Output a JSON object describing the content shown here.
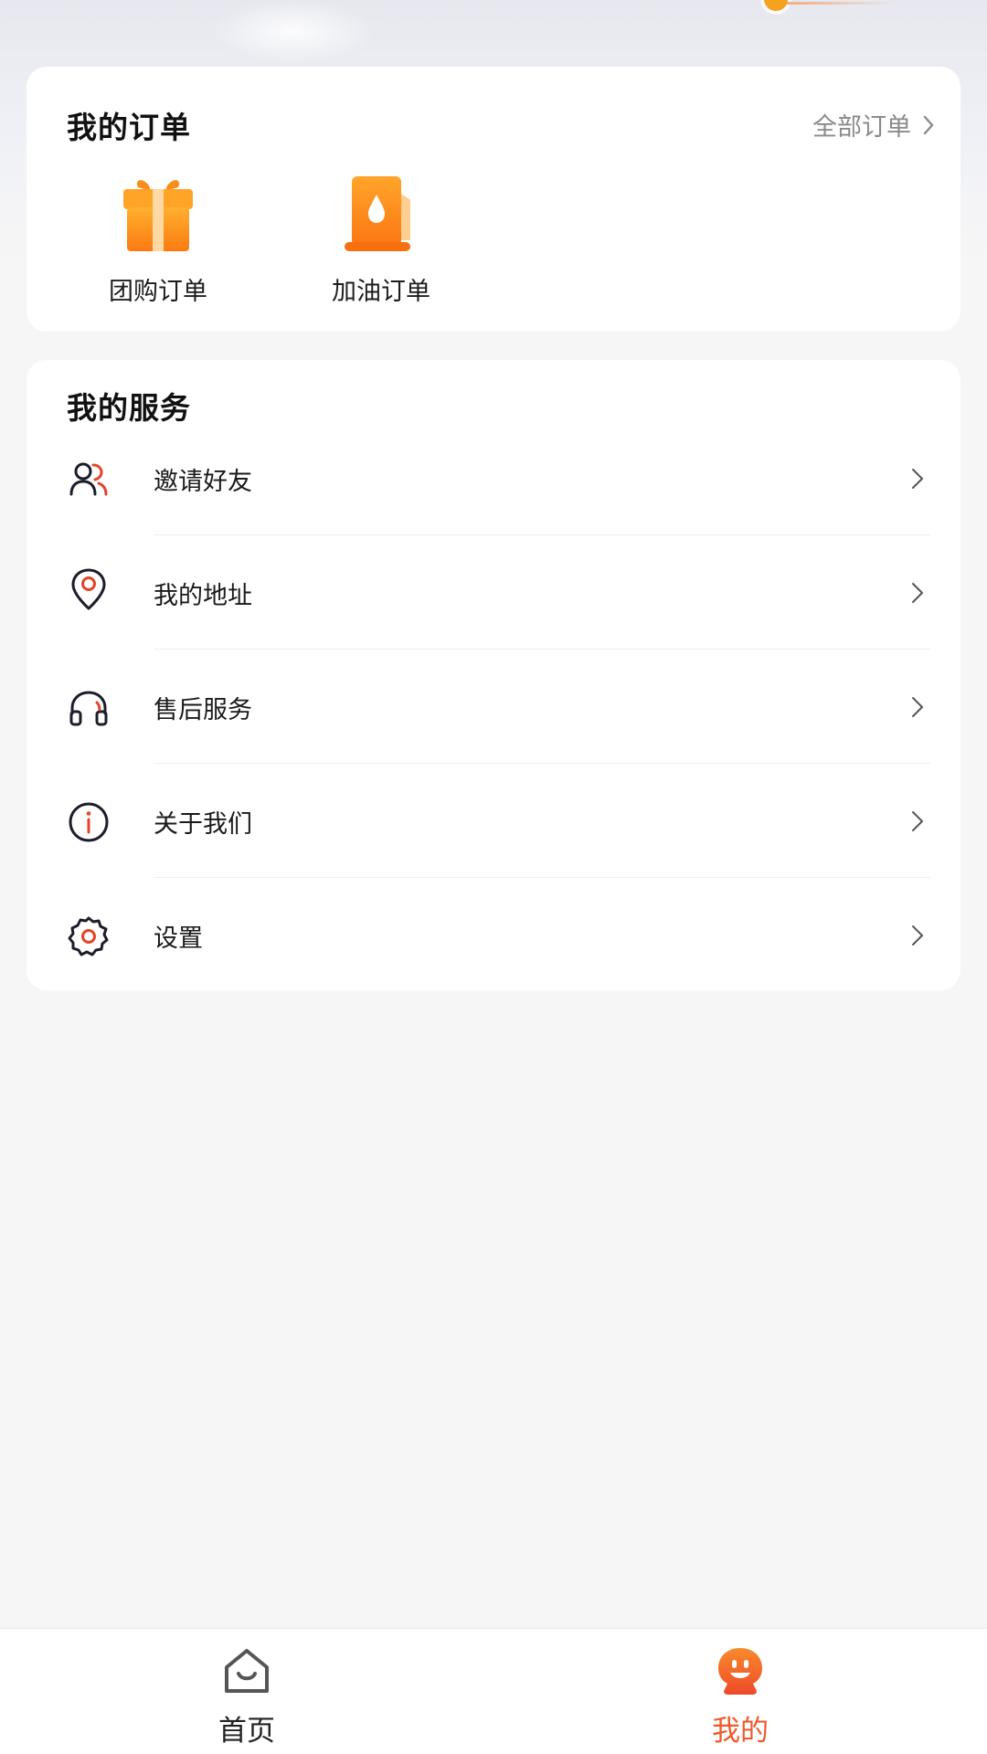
{
  "orders": {
    "title": "我的订单",
    "all_orders_label": "全部订单",
    "entries": [
      {
        "label": "团购订单",
        "icon": "gift-icon"
      },
      {
        "label": "加油订单",
        "icon": "fuel-pump-icon"
      }
    ]
  },
  "services": {
    "title": "我的服务",
    "items": [
      {
        "label": "邀请好友",
        "icon": "invite-friends-icon"
      },
      {
        "label": "我的地址",
        "icon": "location-pin-icon"
      },
      {
        "label": "售后服务",
        "icon": "headset-icon"
      },
      {
        "label": "关于我们",
        "icon": "info-icon"
      },
      {
        "label": "设置",
        "icon": "gear-icon"
      }
    ]
  },
  "tabbar": {
    "tabs": [
      {
        "label": "首页",
        "icon": "home-icon",
        "active": false
      },
      {
        "label": "我的",
        "icon": "profile-face-icon",
        "active": true
      }
    ]
  },
  "colors": {
    "accent": "#ef5a2a",
    "orange": "#fb8a1e",
    "background": "#f6f6f6"
  }
}
